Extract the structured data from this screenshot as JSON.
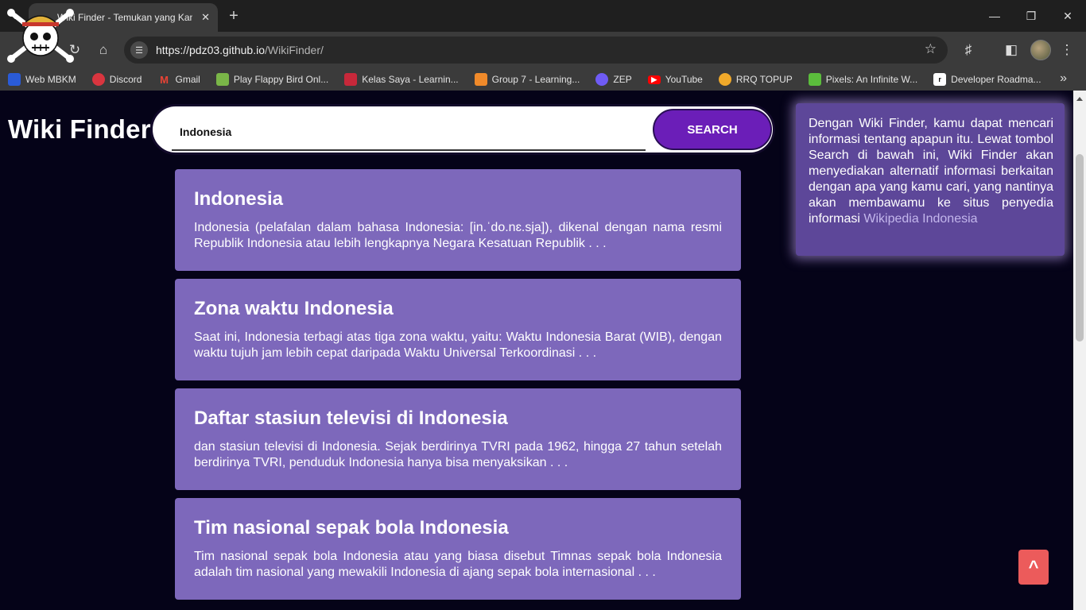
{
  "browser": {
    "tab_title": "Wiki Finder - Temukan yang Kamu Cari",
    "url_host": "https://pdz03.github.io",
    "url_path": "/WikiFinder/",
    "bookmarks": [
      {
        "label": "Web MBKM",
        "color": "#2a5bd7",
        "icon": "mbkm-icon"
      },
      {
        "label": "Discord",
        "color": "#d9353f",
        "icon": "discord-icon"
      },
      {
        "label": "Gmail",
        "color": "#ea4335",
        "icon": "gmail-icon"
      },
      {
        "label": "Play Flappy Bird Onl...",
        "color": "#7ab648",
        "icon": "flappy-bird-icon"
      },
      {
        "label": "Kelas Saya - Learnin...",
        "color": "#c7283a",
        "icon": "learning-icon"
      },
      {
        "label": "Group 7 - Learning...",
        "color": "#f08a2a",
        "icon": "group-icon"
      },
      {
        "label": "ZEP",
        "color": "#6f5bf5",
        "icon": "zep-icon"
      },
      {
        "label": "YouTube",
        "color": "#ff0000",
        "icon": "youtube-icon"
      },
      {
        "label": "RRQ TOPUP",
        "color": "#f0a92a",
        "icon": "rrq-icon"
      },
      {
        "label": "Pixels: An Infinite W...",
        "color": "#5bbd3c",
        "icon": "pixels-icon"
      },
      {
        "label": "Developer Roadma...",
        "color": "#111111",
        "icon": "roadmap-icon"
      }
    ]
  },
  "header": {
    "brand": "Wiki Finder",
    "search_value": "Indonesia",
    "search_button": "SEARCH"
  },
  "results": [
    {
      "title": "Indonesia",
      "snippet": "Indonesia (pelafalan dalam bahasa Indonesia: [in.ˈdo.nɛ.sja]), dikenal dengan nama resmi Republik Indonesia atau lebih lengkapnya Negara Kesatuan Republik . . ."
    },
    {
      "title": "Zona waktu Indonesia",
      "snippet": "Saat ini, Indonesia terbagi atas tiga zona waktu, yaitu: Waktu Indonesia Barat (WIB), dengan waktu tujuh jam lebih cepat daripada Waktu Universal Terkoordinasi . . ."
    },
    {
      "title": "Daftar stasiun televisi di Indonesia",
      "snippet": "dan stasiun televisi di Indonesia. Sejak berdirinya TVRI pada 1962, hingga 27 tahun setelah berdirinya TVRI, penduduk Indonesia hanya bisa menyaksikan . . ."
    },
    {
      "title": "Tim nasional sepak bola Indonesia",
      "snippet": "Tim nasional sepak bola Indonesia atau yang biasa disebut Timnas sepak bola Indonesia adalah tim nasional yang mewakili Indonesia di ajang sepak bola internasional . . ."
    }
  ],
  "info": {
    "text": "Dengan Wiki Finder, kamu dapat mencari informasi tentang apapun itu. Lewat tombol Search di bawah ini, Wiki Finder akan menyediakan alternatif informasi berkaitan dengan apa yang kamu cari, yang nantinya akan membawamu ke situs penyedia informasi",
    "link": "Wikipedia Indonesia"
  },
  "scroll_top_label": "^",
  "colors": {
    "page_bg": "#050318",
    "card": "#7d68bb",
    "info_box": "#5d4799",
    "search_button": "#6b1eb8",
    "scroll_top": "#ec5b5b"
  }
}
